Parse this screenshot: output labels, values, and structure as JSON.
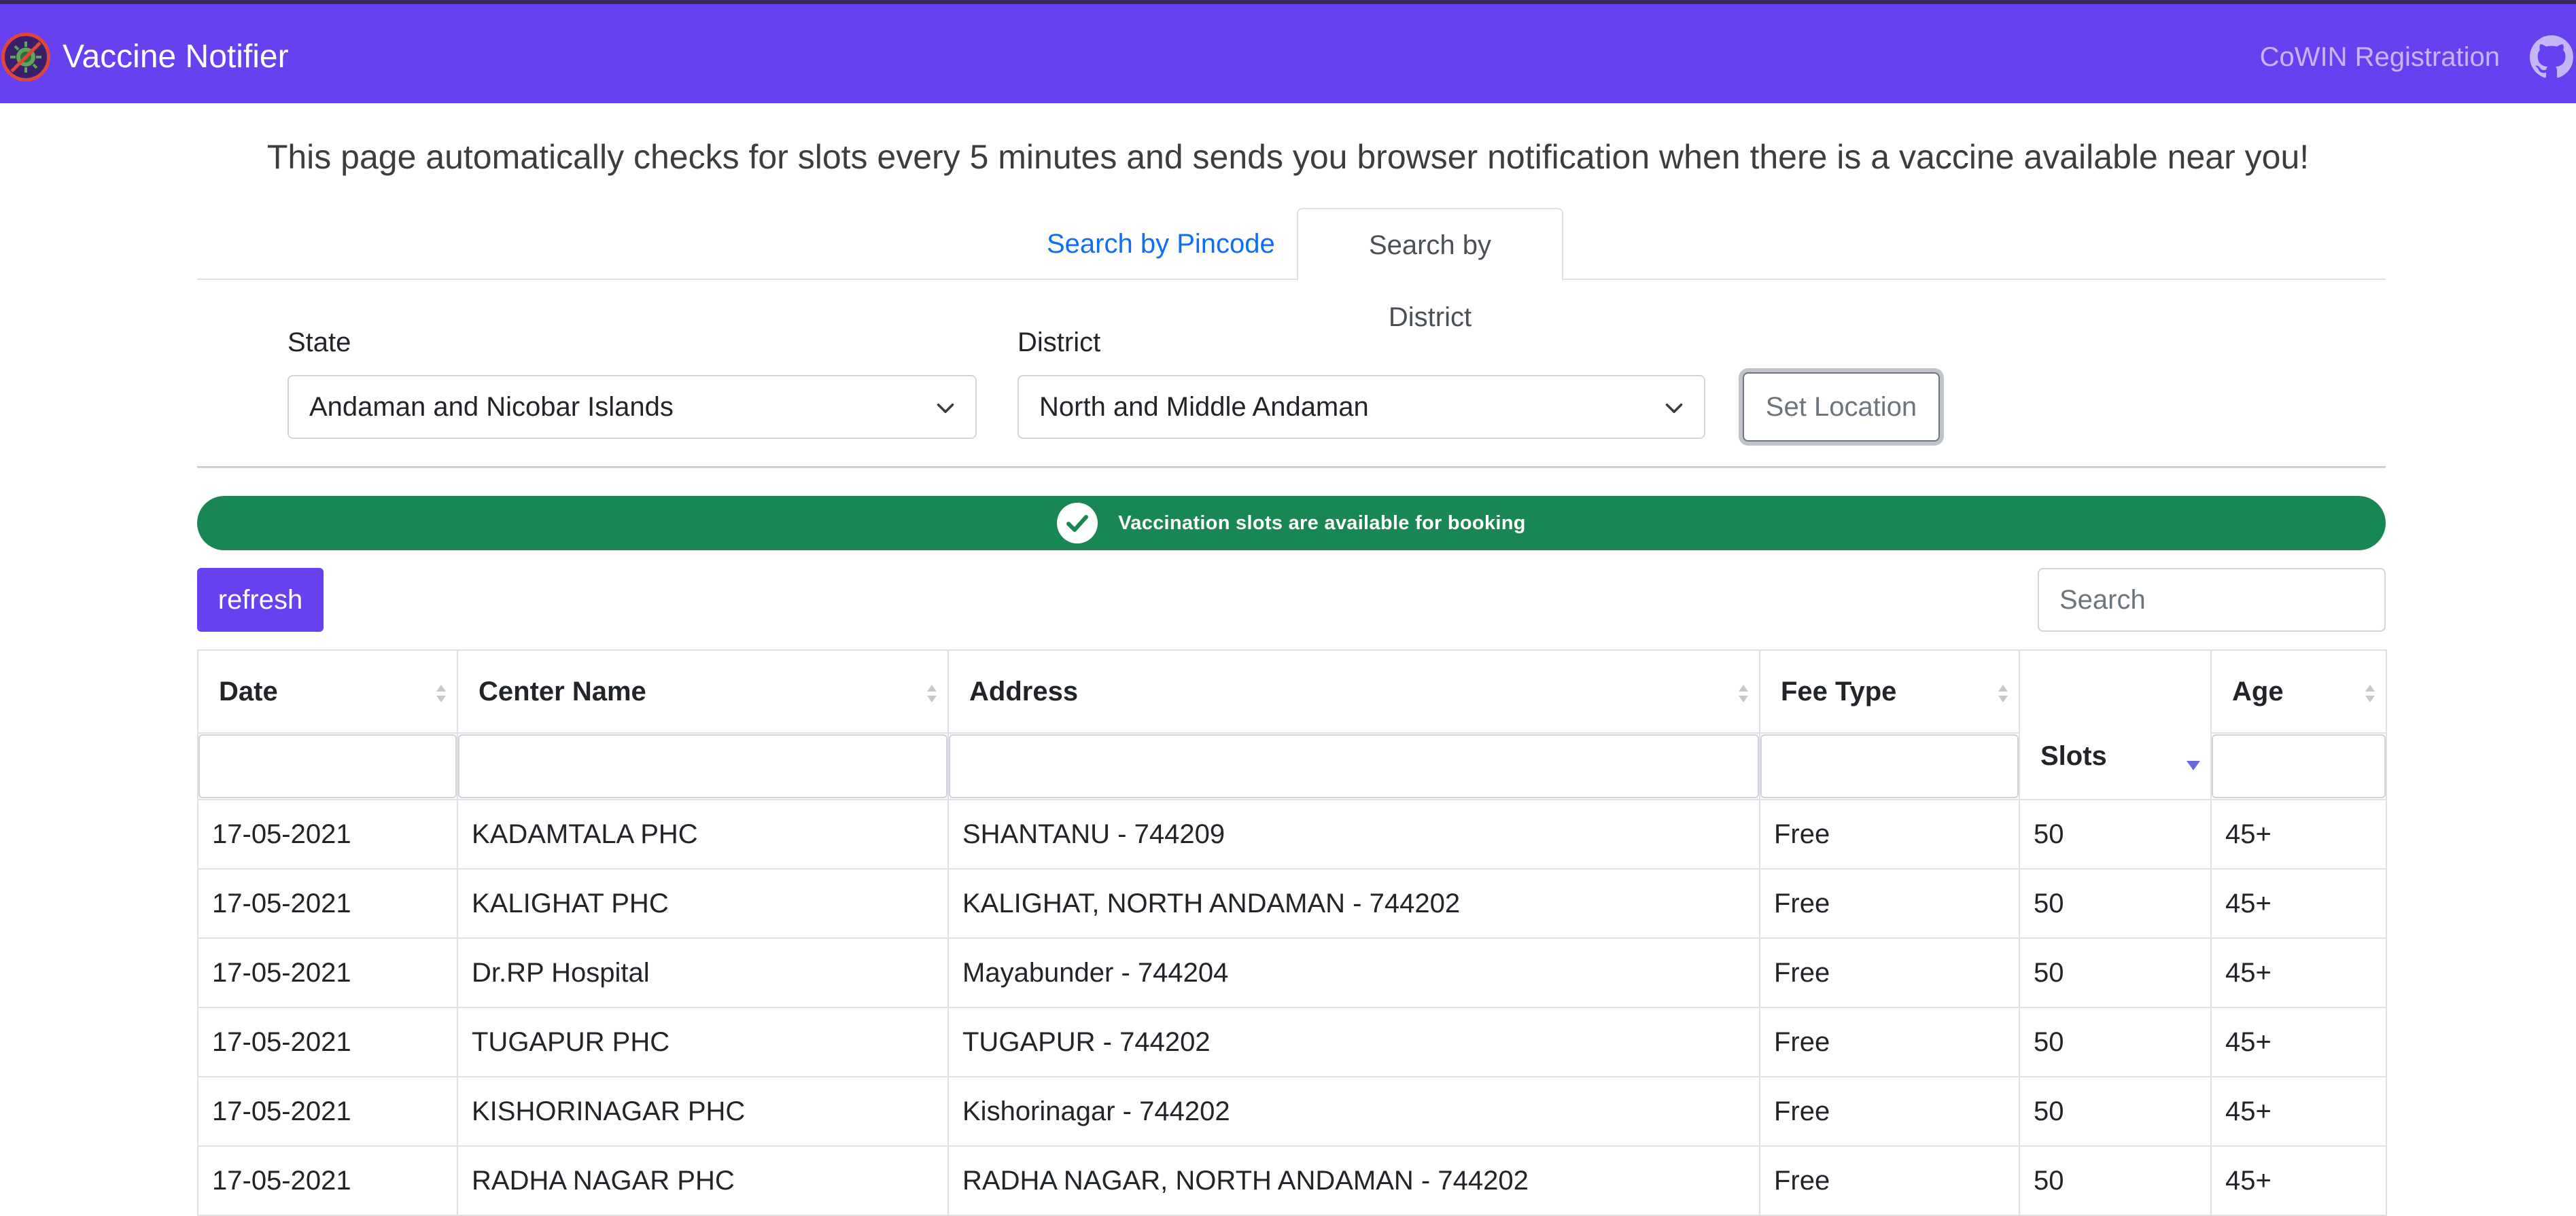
{
  "navbar": {
    "title": "Vaccine Notifier",
    "link_label": "CoWIN Registration",
    "brand_color": "#6741f0"
  },
  "intro_text": "This page automatically checks for slots every 5 minutes and sends you browser notification when there is a vaccine available near you!",
  "tabs": [
    {
      "label": "Search by Pincode",
      "active": false
    },
    {
      "label": "Search by District",
      "active": true
    }
  ],
  "location": {
    "state_label": "State",
    "state_value": "Andaman and Nicobar Islands",
    "district_label": "District",
    "district_value": "North and Middle Andaman",
    "set_button": "Set Location"
  },
  "status": {
    "text": "Vaccination slots are available for booking",
    "color": "#198754"
  },
  "toolbar": {
    "refresh_label": "refresh",
    "search_placeholder": "Search"
  },
  "table": {
    "columns": [
      "Date",
      "Center Name",
      "Address",
      "Fee Type",
      "Slots",
      "Age"
    ],
    "sorted_column": "Slots",
    "rows": [
      [
        "17-05-2021",
        "KADAMTALA PHC",
        "SHANTANU - 744209",
        "Free",
        "50",
        "45+"
      ],
      [
        "17-05-2021",
        "KALIGHAT PHC",
        "KALIGHAT, NORTH ANDAMAN - 744202",
        "Free",
        "50",
        "45+"
      ],
      [
        "17-05-2021",
        "Dr.RP Hospital",
        "Mayabunder - 744204",
        "Free",
        "50",
        "45+"
      ],
      [
        "17-05-2021",
        "TUGAPUR PHC",
        "TUGAPUR - 744202",
        "Free",
        "50",
        "45+"
      ],
      [
        "17-05-2021",
        "KISHORINAGAR PHC",
        "Kishorinagar - 744202",
        "Free",
        "50",
        "45+"
      ],
      [
        "17-05-2021",
        "RADHA NAGAR PHC",
        "RADHA NAGAR, NORTH ANDAMAN - 744202",
        "Free",
        "50",
        "45+"
      ]
    ]
  }
}
